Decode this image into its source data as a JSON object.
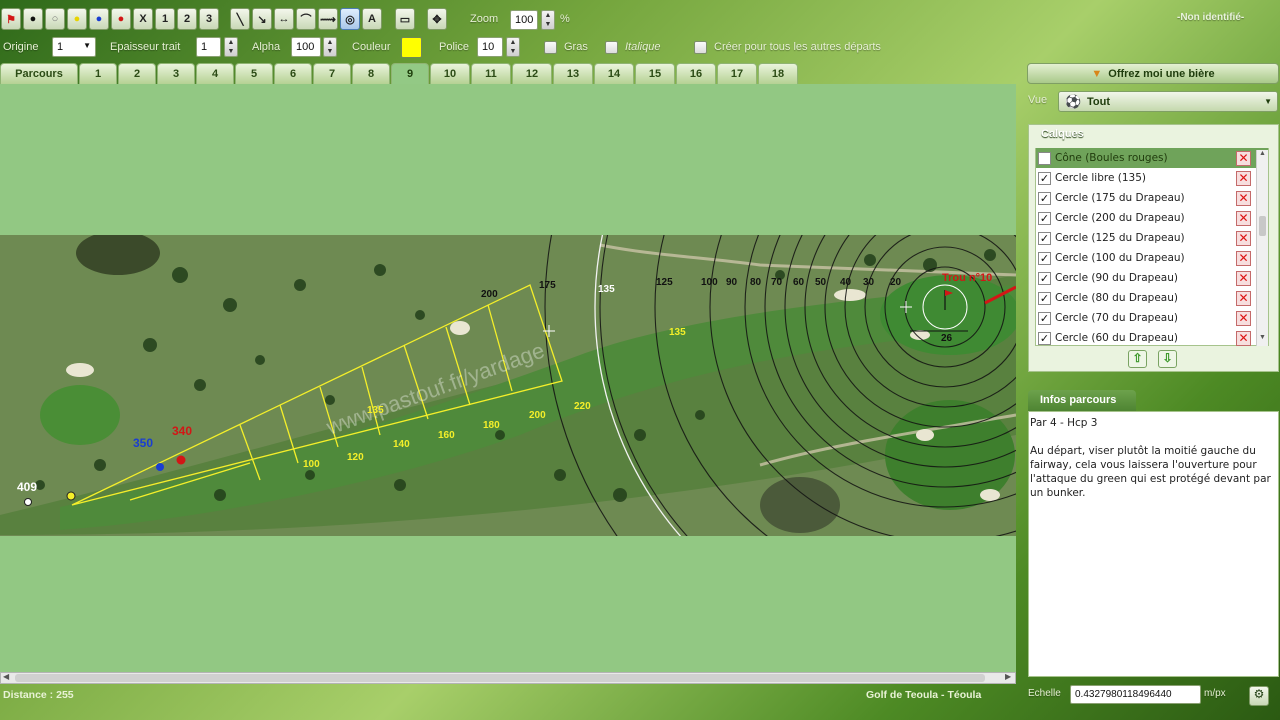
{
  "toolbar": {
    "zoom_label": "Zoom",
    "zoom_value": "100",
    "zoom_unit": "%",
    "user_status": "-Non identifié-",
    "tools": [
      {
        "name": "red-flag-icon",
        "glyph": "⚑",
        "color": "#d31616"
      },
      {
        "name": "black-pin-icon",
        "glyph": "●",
        "color": "#111111"
      },
      {
        "name": "white-pin-icon",
        "glyph": "○",
        "color": "#777777"
      },
      {
        "name": "yellow-pin-icon",
        "glyph": "●",
        "color": "#e8d400"
      },
      {
        "name": "blue-pin-icon",
        "glyph": "●",
        "color": "#1a3ed1"
      },
      {
        "name": "red-pin-icon",
        "glyph": "●",
        "color": "#d31616"
      },
      {
        "name": "tee-x-icon",
        "glyph": "X",
        "color": "#222222"
      },
      {
        "name": "tee-1-icon",
        "glyph": "1",
        "color": "#222222"
      },
      {
        "name": "tee-2-icon",
        "glyph": "2",
        "color": "#222222"
      },
      {
        "name": "tee-3-icon",
        "glyph": "3",
        "color": "#222222"
      }
    ],
    "draw_tools": [
      {
        "name": "line-tool-icon",
        "glyph": "╲"
      },
      {
        "name": "arrow-tool-icon",
        "glyph": "↘"
      },
      {
        "name": "measure-tool-icon",
        "glyph": "↔"
      },
      {
        "name": "curve-tool-icon",
        "glyph": "⌒"
      },
      {
        "name": "distance-tool-icon",
        "glyph": "⟿"
      },
      {
        "name": "circle-tool-icon",
        "glyph": "◎"
      },
      {
        "name": "text-tool-icon",
        "glyph": "A"
      },
      {
        "name": "rectangle-tool-icon",
        "glyph": "▭"
      },
      {
        "name": "move-tool-icon",
        "glyph": "✥"
      }
    ]
  },
  "options": {
    "origin_label": "Origine",
    "origin_value": "1",
    "thickness_label": "Epaisseur trait",
    "thickness_value": "1",
    "alpha_label": "Alpha",
    "alpha_value": "100",
    "color_label": "Couleur",
    "color_value": "#ffff00",
    "font_label": "Police",
    "font_value": "10",
    "bold_label": "Gras",
    "italic_label": "Italique",
    "all_tees_label": "Créer pour tous les autres départs"
  },
  "tabs": [
    {
      "label": "Parcours",
      "active": false
    },
    {
      "label": "1",
      "active": false
    },
    {
      "label": "2",
      "active": false
    },
    {
      "label": "3",
      "active": false
    },
    {
      "label": "4",
      "active": false
    },
    {
      "label": "5",
      "active": false
    },
    {
      "label": "6",
      "active": false
    },
    {
      "label": "7",
      "active": false
    },
    {
      "label": "8",
      "active": false
    },
    {
      "label": "9",
      "active": true
    },
    {
      "label": "10",
      "active": false
    },
    {
      "label": "11",
      "active": false
    },
    {
      "label": "12",
      "active": false
    },
    {
      "label": "13",
      "active": false
    },
    {
      "label": "14",
      "active": false
    },
    {
      "label": "15",
      "active": false
    },
    {
      "label": "16",
      "active": false
    },
    {
      "label": "17",
      "active": false
    },
    {
      "label": "18",
      "active": false
    }
  ],
  "map": {
    "tee_distances": {
      "white": "409",
      "blue": "350",
      "red": "340"
    },
    "watermark": "www.pastouf.fr/yardage",
    "hole_label": "Trou n°10",
    "cone_labels": [
      "100",
      "120",
      "140",
      "160",
      "180",
      "200",
      "220"
    ],
    "cone_top_labels": [
      "200",
      "175"
    ],
    "target_labels": [
      "135",
      "135"
    ],
    "ring_labels": [
      "135",
      "125",
      "100",
      "90",
      "80",
      "70",
      "60",
      "50",
      "40",
      "30",
      "20"
    ],
    "green_label": "26"
  },
  "panel": {
    "beer_button": "Offrez moi une bière",
    "view_label": "Vue",
    "view_value": "Tout",
    "layers_title": "Calques",
    "layers": [
      {
        "label": "Cône (Boules rouges)",
        "checked": false,
        "selected": true
      },
      {
        "label": "Cercle libre (135)",
        "checked": true,
        "selected": false
      },
      {
        "label": "Cercle (175 du Drapeau)",
        "checked": true,
        "selected": false
      },
      {
        "label": "Cercle (200 du Drapeau)",
        "checked": true,
        "selected": false
      },
      {
        "label": "Cercle (125 du Drapeau)",
        "checked": true,
        "selected": false
      },
      {
        "label": "Cercle (100 du Drapeau)",
        "checked": true,
        "selected": false
      },
      {
        "label": "Cercle (90 du Drapeau)",
        "checked": true,
        "selected": false
      },
      {
        "label": "Cercle (80 du Drapeau)",
        "checked": true,
        "selected": false
      },
      {
        "label": "Cercle (70 du Drapeau)",
        "checked": true,
        "selected": false
      },
      {
        "label": "Cercle (60 du Drapeau)",
        "checked": true,
        "selected": false
      }
    ],
    "info_title": "Infos parcours",
    "info_heading": "Par 4 - Hcp 3",
    "info_body": "Au départ, viser plutôt la moitié gauche du fairway, cela vous laissera l'ouverture pour l'attaque du green qui est protégé devant par un bunker."
  },
  "status": {
    "distance": "Distance : 255",
    "course": "Golf de Teoula - Téoula",
    "scale_label": "Echelle",
    "scale_value": "0.4327980118496440",
    "scale_unit": "m/px"
  },
  "colors": {
    "map_bg": "#92c883",
    "cone": "#f4ef2a",
    "selected_layer": "#6fa35a"
  }
}
